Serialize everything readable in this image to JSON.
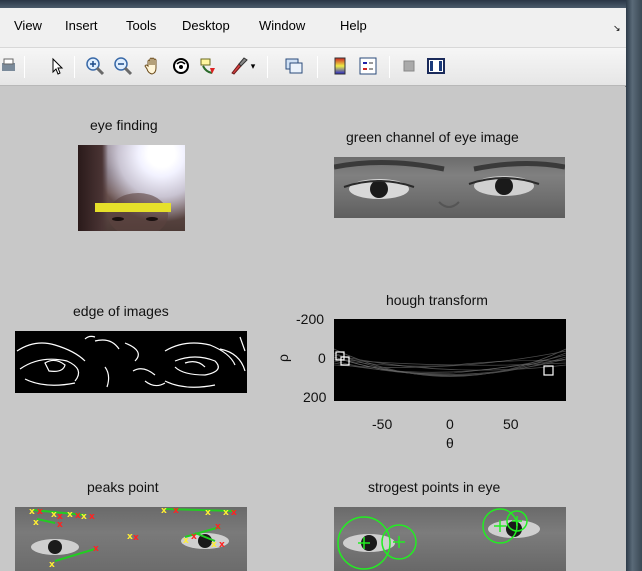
{
  "menubar": {
    "items": [
      "View",
      "Insert",
      "Tools",
      "Desktop",
      "Window",
      "Help"
    ],
    "overflow_icon": "chevron-down-small-icon"
  },
  "toolbar": {
    "icons": [
      "print-icon",
      "pointer-arrow-icon",
      "zoom-in-icon",
      "zoom-out-icon",
      "pan-hand-icon",
      "rotate-3d-icon",
      "data-cursor-icon",
      "brush-icon",
      "brush-dropdown-icon",
      "link-plot-icon",
      "insert-colorbar-icon",
      "insert-legend-icon",
      "hide-plot-tools-icon",
      "show-plot-tools-icon"
    ]
  },
  "figure": {
    "subplots": {
      "eye_finding": {
        "title": "eye finding"
      },
      "green_channel": {
        "title": "green channel of eye image"
      },
      "edge": {
        "title": "edge of images"
      },
      "hough": {
        "title": "hough  transform",
        "ylabel": "ρ",
        "xlabel": "θ",
        "yticks": [
          "-200",
          "0",
          "200"
        ],
        "xticks": [
          "-50",
          "0",
          "50"
        ]
      },
      "peaks": {
        "title": "peaks point"
      },
      "strongest": {
        "title": "strogest points in eye"
      }
    }
  },
  "colors": {
    "figure_bg": "#c8c8c8",
    "menubar_bg": "#f0f0f0",
    "peak_marker": "#ffee33",
    "line_segment": "#22cc22",
    "line_endpoint": "#ff2222",
    "circle": "#22ee22"
  }
}
